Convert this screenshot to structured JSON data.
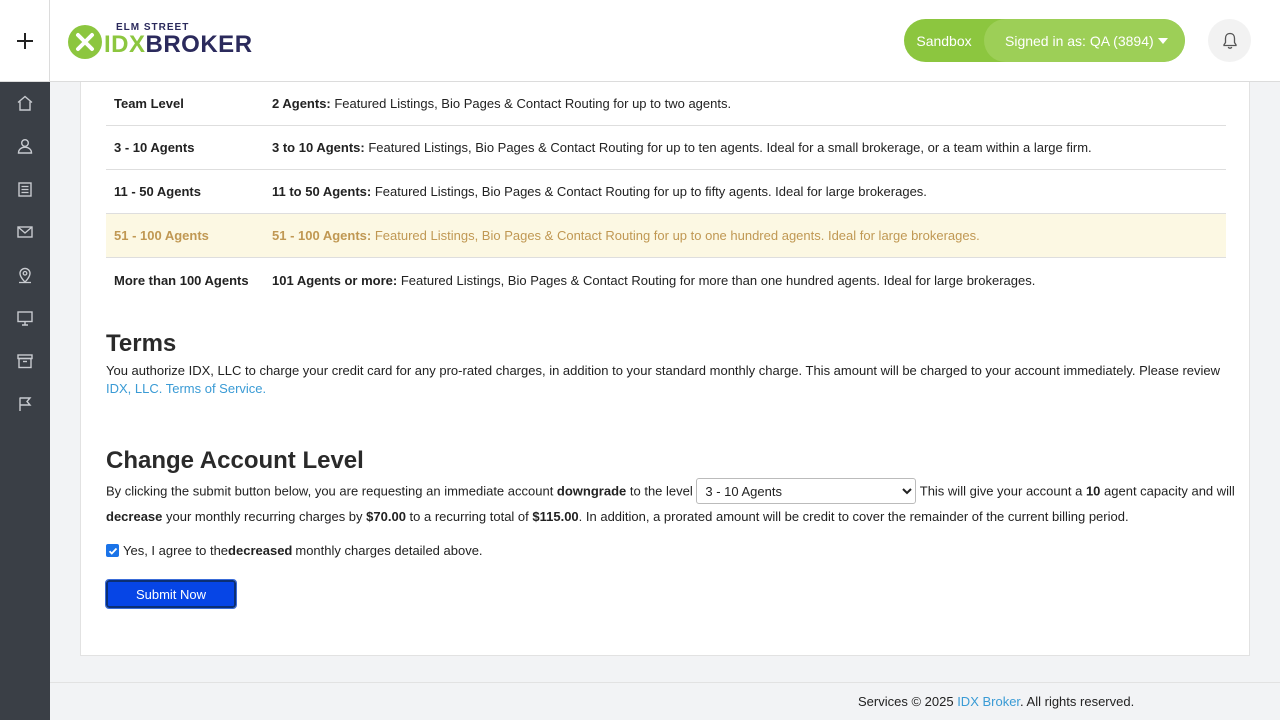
{
  "header": {
    "logo_small": "ELM STREET",
    "logo_idx": "IDX",
    "logo_broker": "BROKER",
    "sandbox_label": "Sandbox",
    "signed_in_label": "Signed in as: QA (3894)"
  },
  "sidebar": {
    "icons": [
      "home-icon",
      "user-icon",
      "listings-icon",
      "mail-icon",
      "map-pin-icon",
      "monitor-icon",
      "archive-icon",
      "flag-icon"
    ]
  },
  "levels": [
    {
      "name": "Team Level",
      "desc_bold": "2 Agents:",
      "desc": " Featured Listings, Bio Pages & Contact Routing for up to two agents."
    },
    {
      "name": "3 - 10 Agents",
      "desc_bold": "3 to 10 Agents:",
      "desc": " Featured Listings, Bio Pages & Contact Routing for up to ten agents. Ideal for a small brokerage, or a team within a large firm."
    },
    {
      "name": "11 - 50 Agents",
      "desc_bold": "11 to 50 Agents:",
      "desc": " Featured Listings, Bio Pages & Contact Routing for up to fifty agents. Ideal for large brokerages."
    },
    {
      "name": "51 - 100 Agents",
      "desc_bold": "51 - 100 Agents:",
      "desc": " Featured Listings, Bio Pages & Contact Routing for up to one hundred agents. Ideal for large brokerages."
    },
    {
      "name": "More than 100 Agents",
      "desc_bold": "101 Agents or more:",
      "desc": " Featured Listings, Bio Pages & Contact Routing for more than one hundred agents. Ideal for large brokerages."
    }
  ],
  "terms": {
    "heading": "Terms",
    "text": "You authorize IDX, LLC to charge your credit card for any pro-rated charges, in addition to your standard monthly charge. This amount will be charged to your account immediately. Please review",
    "link": "IDX, LLC. Terms of Service."
  },
  "change": {
    "heading": "Change Account Level",
    "t1": "By clicking the submit button below, you are requesting an immediate account ",
    "b1": "downgrade",
    "t2": " to the level ",
    "selected_level": "3 - 10 Agents",
    "t3": " This will give your account a ",
    "b2": "10",
    "t4": " agent capacity and will ",
    "b3": "decrease",
    "t5": " your monthly recurring charges by ",
    "b4": "$70.00",
    "t6": " to a recurring total of ",
    "b5": "$115.00",
    "t7": ". In addition, a prorated amount will be credit to cover the remainder of the current billing period."
  },
  "agree": {
    "t1": "Yes, I agree to the ",
    "b1": "decreased",
    "t2": " monthly charges detailed above.",
    "checked": true
  },
  "submit_label": "Submit Now",
  "footer": {
    "prefix": "Services © 2025 ",
    "link": "IDX Broker",
    "suffix": ". All rights reserved."
  },
  "colors": {
    "brand_green": "#8cc63f",
    "brand_navy": "#2b2a5c",
    "highlight_row": "#fcf8e3",
    "link": "#3a9bd5",
    "submit": "#0645e6"
  }
}
